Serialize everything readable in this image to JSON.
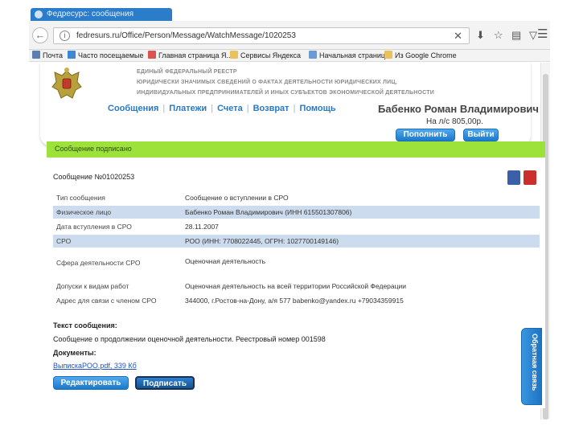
{
  "browser": {
    "tab_title": "Федресурс: сообщения",
    "url": "fedresurs.ru/Office/Person/Message/WatchMessage/1020253",
    "info_icon": "i",
    "clear_icon": "✕",
    "bookmarks": [
      {
        "label": "Почта",
        "icon": "mail-icon",
        "color": "#5a7fb0"
      },
      {
        "label": "Часто посещаемые",
        "icon": "frequent-icon",
        "color": "#3d88d2"
      },
      {
        "label": "Главная страница Я...",
        "icon": "page-icon",
        "color": "#d9534f"
      },
      {
        "label": "Сервисы Яндекса",
        "icon": "folder-icon",
        "color": "#e8c25a"
      },
      {
        "label": "Начальная страница",
        "icon": "page-icon",
        "color": "#6b9bd6"
      },
      {
        "label": "Из Google Chrome",
        "icon": "folder-icon",
        "color": "#e8c25a"
      }
    ]
  },
  "header": {
    "registry_lines": [
      "ЕДИНЫЙ ФЕДЕРАЛЬНЫЙ РЕЕСТР",
      "ЮРИДИЧЕСКИ ЗНАЧИМЫХ СВЕДЕНИЙ О ФАКТАХ ДЕЯТЕЛЬНОСТИ ЮРИДИЧЕСКИХ ЛИЦ,",
      "ИНДИВИДУАЛЬНЫХ ПРЕДПРИНИМАТЕЛЕЙ И ИНЫХ СУБЪЕКТОВ ЭКОНОМИЧЕСКОЙ ДЕЯТЕЛЬНОСТИ"
    ],
    "menu": [
      "Сообщения",
      "Платежи",
      "Счета",
      "Возврат",
      "Помощь"
    ],
    "user_name": "Бабенко Роман Владимирович",
    "balance": "На л/с 805,00р.",
    "topup_button": "Пополнить",
    "logout_button": "Выйти"
  },
  "message": {
    "status": "Сообщение подписано",
    "number": "Сообщение №01020253",
    "rows": [
      {
        "label": "Тип сообщения",
        "value": "Сообщение о вступлении в СРО"
      },
      {
        "label": "Физическое лицо",
        "value": "Бабенко Роман Владимирович (ИНН 615501307806)"
      },
      {
        "label": "Дата вступления в СРО",
        "value": "28.11.2007"
      },
      {
        "label": "СРО",
        "value": "РОО (ИНН: 7708022445, ОГРН: 1027700149146)"
      },
      {
        "label": "Сфера деятельности СРО",
        "value": "Оценочная деятельность"
      },
      {
        "label": "Допуски к видам работ",
        "value": "Оценочная деятельность на всей территории Российской Федерации"
      },
      {
        "label": "Адрес для связи с членом СРО",
        "value": "344000, г.Ростов-на-Дону, а/я 577 babenko@yandex.ru +79034359915"
      }
    ],
    "text_label": "Текст сообщения:",
    "text_body": "Сообщение о продолжении оценочной деятельности. Реестровый номер 001598",
    "documents_label": "Документы:",
    "file_link": "ВыпискаРОО.pdf, 339 Кб",
    "edit_button": "Редактировать",
    "sign_button": "Подписать",
    "feedback_tab": "Обратная связь"
  },
  "colors": {
    "brand_blue": "#2b79c2",
    "signed_green": "#9de23a",
    "row_alt": "#ccdcee"
  }
}
